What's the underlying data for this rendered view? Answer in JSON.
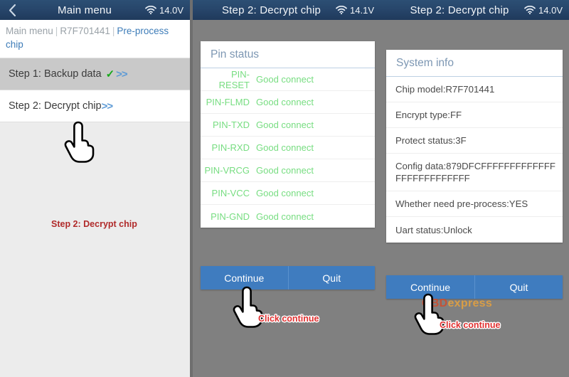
{
  "panel1": {
    "titlebar": {
      "back_icon": "chevron-left-icon",
      "title": "Main menu",
      "wifi_icon": "wifi-icon",
      "voltage": "14.0V"
    },
    "breadcrumb": {
      "item1": "Main menu",
      "sep": "|",
      "item2": "R7F701441",
      "item3": "Pre-process chip"
    },
    "steps": [
      {
        "label": "Step 1: Backup data",
        "check": "✓",
        "arrows": ">>",
        "state": "done"
      },
      {
        "label": "Step 2: Decrypt chip",
        "check": "",
        "arrows": ">>",
        "state": "current"
      }
    ],
    "annotation": "Step 2: Decrypt chip",
    "cursor_icon": "pointing-hand-cursor"
  },
  "panel2": {
    "titlebar": {
      "title": "Step 2: Decrypt chip",
      "wifi_icon": "wifi-icon",
      "voltage": "14.1V"
    },
    "card": {
      "title": "Pin status",
      "rows": [
        {
          "pin": "PIN-RESET",
          "status": "Good connect"
        },
        {
          "pin": "PIN-FLMD",
          "status": "Good connect"
        },
        {
          "pin": "PIN-TXD",
          "status": "Good connect"
        },
        {
          "pin": "PIN-RXD",
          "status": "Good connect"
        },
        {
          "pin": "PIN-VRCG",
          "status": "Good connect"
        },
        {
          "pin": "PIN-VCC",
          "status": "Good connect"
        },
        {
          "pin": "PIN-GND",
          "status": "Good connect"
        }
      ]
    },
    "buttons": {
      "continue": "Continue",
      "quit": "Quit"
    },
    "annotation": "Click continue",
    "cursor_icon": "pointing-hand-cursor"
  },
  "panel3": {
    "titlebar": {
      "title": "Step 2: Decrypt chip",
      "wifi_icon": "wifi-icon",
      "voltage": "14.0V"
    },
    "card": {
      "title": "System info",
      "rows": [
        "Chip model:R7F701441",
        "Encrypt type:FF",
        "Protect status:3F",
        "Config data:879DFCFFFFFFFFFFFFFFFFFFFFFFFFFF",
        "Whether need pre-process:YES",
        "Uart status:Unlock"
      ]
    },
    "buttons": {
      "continue": "Continue",
      "quit": "Quit"
    },
    "annotation": "Click continue",
    "cursor_icon": "pointing-hand-cursor",
    "watermark": {
      "part1": "OBD",
      "part2": "express"
    }
  },
  "colors": {
    "titlebar": "#27456a",
    "accent_blue": "#3f7cbf",
    "pin_green": "#77dd81",
    "annotation_red": "#e03030",
    "card_title": "#7d97b3"
  }
}
